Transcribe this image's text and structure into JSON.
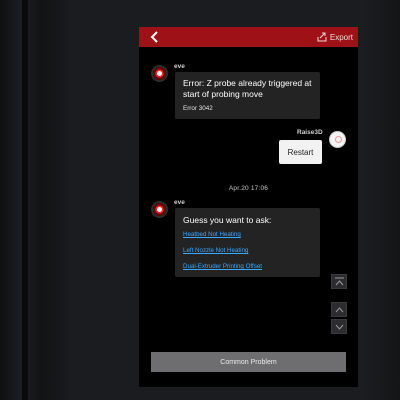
{
  "header": {
    "export_label": "Export"
  },
  "messages": {
    "error": {
      "sender": "eve",
      "title": "Error: Z probe already triggered at start of probing move",
      "code": "Error 3042"
    },
    "user_reply": {
      "sender": "Raise3D",
      "text": "Restart"
    },
    "timestamp": "Apr.20   17:06",
    "suggestions": {
      "sender": "eve",
      "title": "Guess you want to ask:",
      "links": [
        "Heatbed Not Heating",
        "Left Nozzle Not Heating",
        "Dual-Extruder Printing Offset"
      ]
    }
  },
  "footer": {
    "common_problem_label": "Common Problem"
  },
  "colors": {
    "topbar": "#9e1116",
    "link": "#3ea8ff",
    "bubble": "#232323"
  },
  "icons": {
    "back": "chevron-left-icon",
    "export": "export-icon",
    "collapse": "collapse-icon",
    "scroll_up": "chevron-up-icon",
    "scroll_down": "chevron-down-icon"
  }
}
